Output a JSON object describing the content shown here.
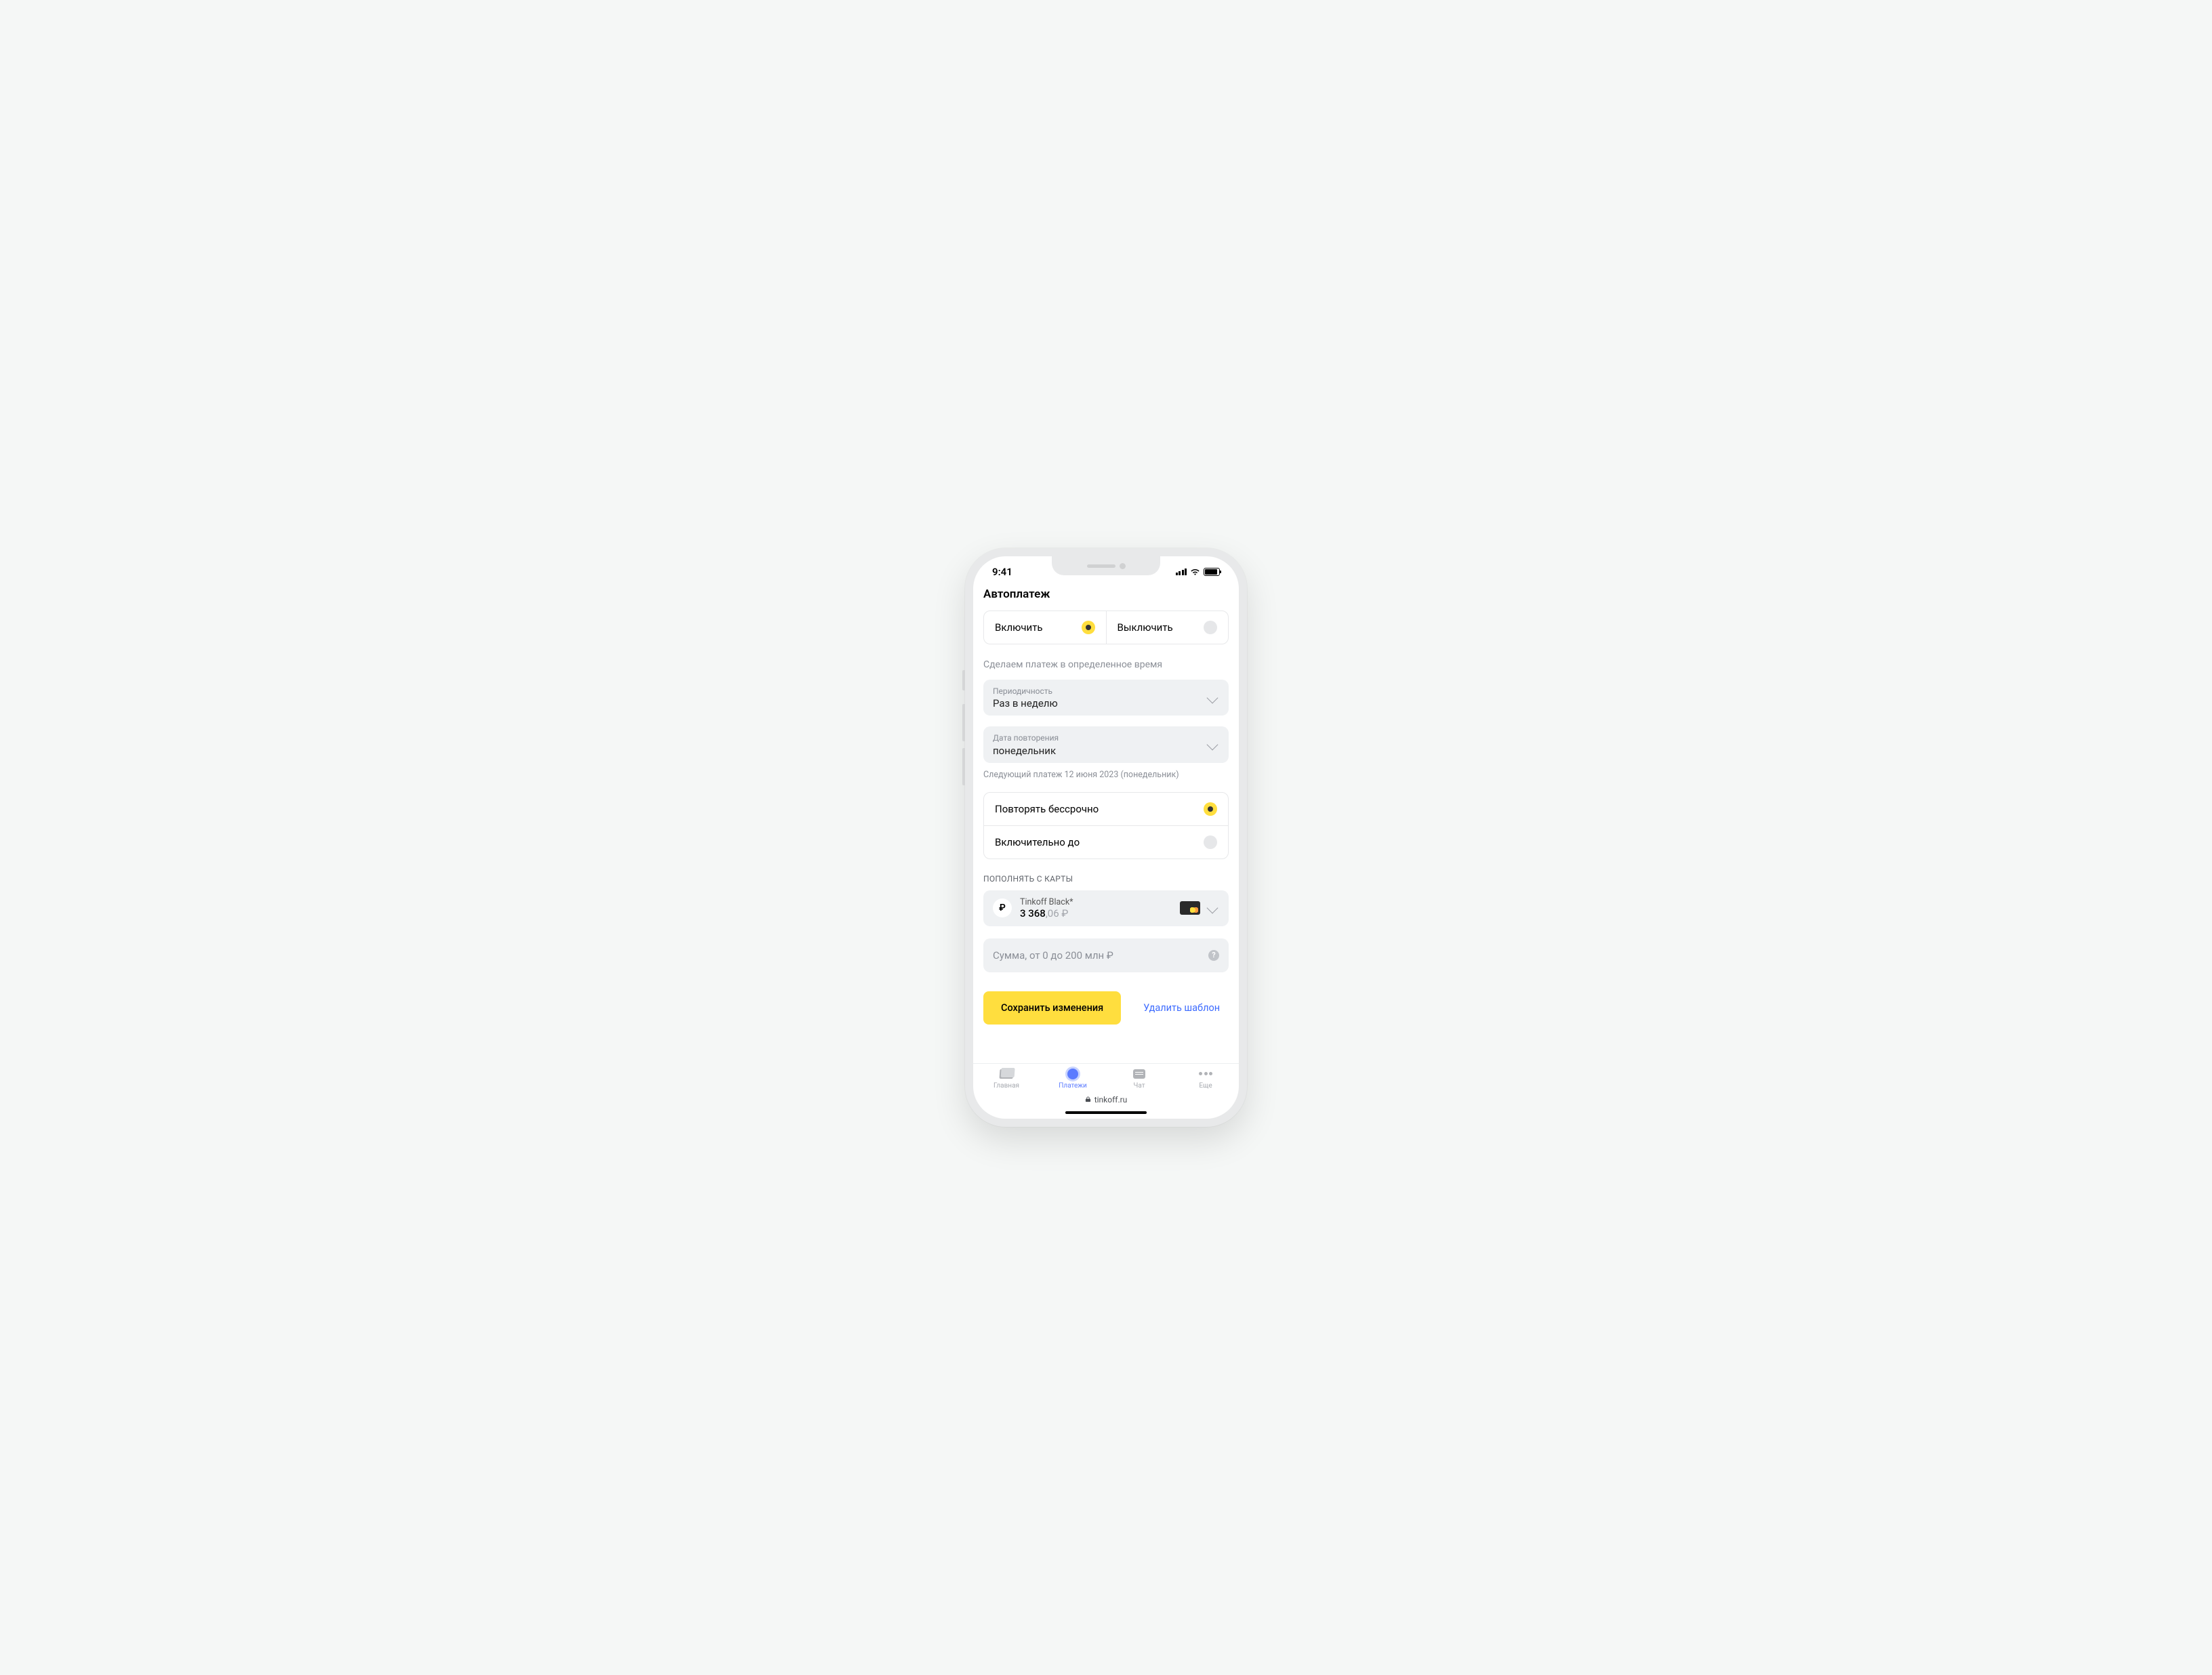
{
  "statusbar": {
    "time": "9:41"
  },
  "page": {
    "title": "Автоплатеж"
  },
  "toggle": {
    "on": "Включить",
    "off": "Выключить"
  },
  "hint": "Сделаем платеж в определенное время",
  "period": {
    "label": "Периодичность",
    "value": "Раз в неделю"
  },
  "repeat": {
    "label": "Дата повторения",
    "value": "понедельник"
  },
  "nextDate": "Следующий платеж 12 июня 2023 (понедельник)",
  "duration": {
    "forever": "Повторять бессрочно",
    "until": "Включительно до"
  },
  "cardSection": "ПОПОЛНЯТЬ С КАРТЫ",
  "card": {
    "name": "Tinkoff Black*",
    "balanceMain": "3 368",
    "balanceDim": ",06 ₽",
    "currency": "₽"
  },
  "amount": {
    "placeholder": "Сумма, от 0 до 200 млн ₽"
  },
  "actions": {
    "save": "Сохранить изменения",
    "delete": "Удалить шаблон"
  },
  "tabs": {
    "home": "Главная",
    "payments": "Платежи",
    "chat": "Чат",
    "more": "Еще"
  },
  "url": "tinkoff.ru"
}
